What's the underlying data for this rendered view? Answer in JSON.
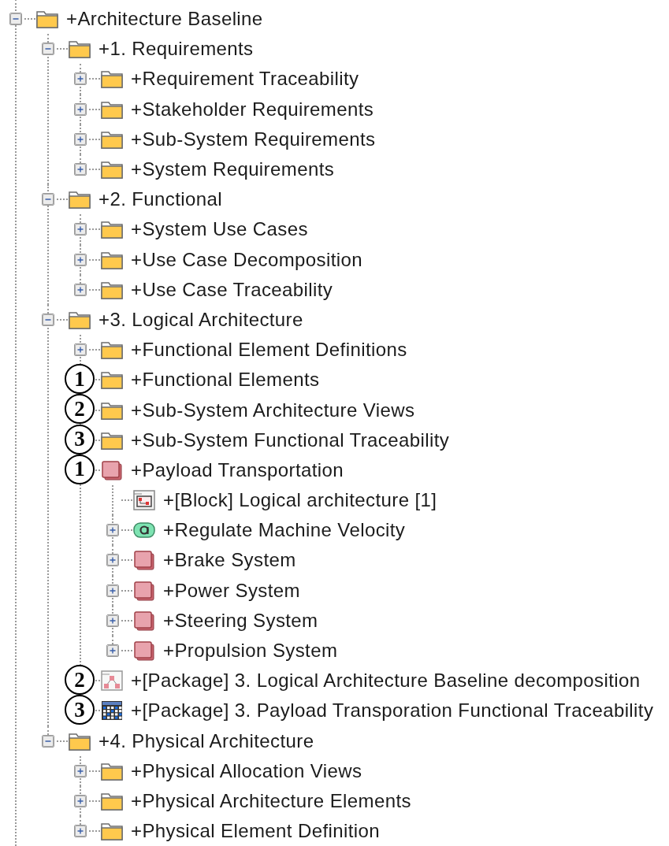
{
  "tree": {
    "label": "+Architecture Baseline",
    "kind": "folder",
    "expanded": true,
    "children": [
      {
        "label": "+1. Requirements",
        "kind": "folder",
        "expanded": true,
        "children": [
          {
            "label": "+Requirement Traceability",
            "kind": "folder",
            "expanded": false
          },
          {
            "label": "+Stakeholder Requirements",
            "kind": "folder",
            "expanded": false
          },
          {
            "label": "+Sub-System Requirements",
            "kind": "folder",
            "expanded": false
          },
          {
            "label": "+System Requirements",
            "kind": "folder",
            "expanded": false
          }
        ]
      },
      {
        "label": "+2. Functional",
        "kind": "folder",
        "expanded": true,
        "children": [
          {
            "label": "+System Use Cases",
            "kind": "folder",
            "expanded": false
          },
          {
            "label": "+Use Case Decomposition",
            "kind": "folder",
            "expanded": false
          },
          {
            "label": "+Use Case Traceability",
            "kind": "folder",
            "expanded": false
          }
        ]
      },
      {
        "label": "+3. Logical Architecture",
        "kind": "folder",
        "expanded": true,
        "children": [
          {
            "label": "+Functional Element Definitions",
            "kind": "folder",
            "expanded": false
          },
          {
            "label": "+Functional Elements",
            "kind": "folder",
            "callout": "1"
          },
          {
            "label": "+Sub-System Architecture Views",
            "kind": "folder",
            "callout": "2"
          },
          {
            "label": "+Sub-System Functional Traceability",
            "kind": "folder",
            "callout": "3"
          },
          {
            "label": "+Payload Transportation",
            "kind": "block",
            "callout": "1",
            "children": [
              {
                "label": "+[Block] Logical architecture [1]",
                "kind": "block-diagram"
              },
              {
                "label": "+Regulate Machine Velocity",
                "kind": "activity",
                "expanded": false
              },
              {
                "label": "+Brake System",
                "kind": "block",
                "expanded": false
              },
              {
                "label": "+Power System",
                "kind": "block",
                "expanded": false
              },
              {
                "label": "+Steering System",
                "kind": "block",
                "expanded": false
              },
              {
                "label": "+Propulsion System",
                "kind": "block",
                "expanded": false
              }
            ]
          },
          {
            "label": "+[Package] 3. Logical Architecture Baseline decomposition",
            "kind": "package-diagram",
            "callout": "2"
          },
          {
            "label": "+[Package] 3. Payload Transporation Functional Traceability",
            "kind": "matrix",
            "callout": "3"
          }
        ]
      },
      {
        "label": "+4. Physical Architecture",
        "kind": "folder",
        "expanded": true,
        "children": [
          {
            "label": "+Physical Allocation Views",
            "kind": "folder",
            "expanded": false
          },
          {
            "label": "+Physical Architecture Elements",
            "kind": "folder",
            "expanded": false
          },
          {
            "label": "+Physical Element Definition",
            "kind": "folder",
            "expanded": false
          }
        ]
      }
    ]
  }
}
